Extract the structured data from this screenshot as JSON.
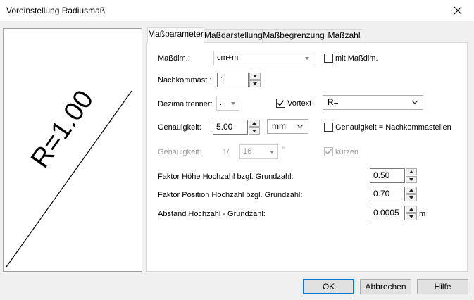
{
  "window": {
    "title": "Voreinstellung Radiusmaß"
  },
  "preview": {
    "text": "R=1.00"
  },
  "tabs": [
    {
      "label": "Maßparameter"
    },
    {
      "label": "Maßdarstellung"
    },
    {
      "label": "Maßbegrenzung"
    },
    {
      "label": "Maßzahl"
    }
  ],
  "form": {
    "massdim_label": "Maßdim.:",
    "massdim_value": "cm+m",
    "mit_massdim_label": "mit Maßdim.",
    "mit_massdim_checked": false,
    "nachkommast_label": "Nachkommast.:",
    "nachkommast_value": "1",
    "dezimaltrenner_label": "Dezimaltrenner:",
    "dezimaltrenner_value": ".",
    "vortext_label": "Vortext",
    "vortext_checked": true,
    "vortext_value": "R=",
    "genauigkeit_label": "Genauigkeit:",
    "genauigkeit_value": "5.00",
    "genauigkeit_unit": "mm",
    "genauigkeit_eq_label": "Genauigkeit = Nachkommastellen",
    "genauigkeit_eq_checked": false,
    "genauigkeit2_label": "Genauigkeit:",
    "fraction_prefix": "1/",
    "fraction_value": "16",
    "fraction_suffix": "\"",
    "kuerzen_label": "kürzen",
    "kuerzen_checked": true,
    "faktor_hoehe_label": "Faktor Höhe Hochzahl bzgl. Grundzahl:",
    "faktor_hoehe_value": "0.50",
    "faktor_pos_label": "Faktor Position Hochzahl bzgl. Grundzahl:",
    "faktor_pos_value": "0.70",
    "abstand_label": "Abstand Hochzahl - Grundzahl:",
    "abstand_value": "0.0005",
    "abstand_unit": "m"
  },
  "buttons": {
    "ok": "OK",
    "cancel": "Abbrechen",
    "help": "Hilfe"
  }
}
